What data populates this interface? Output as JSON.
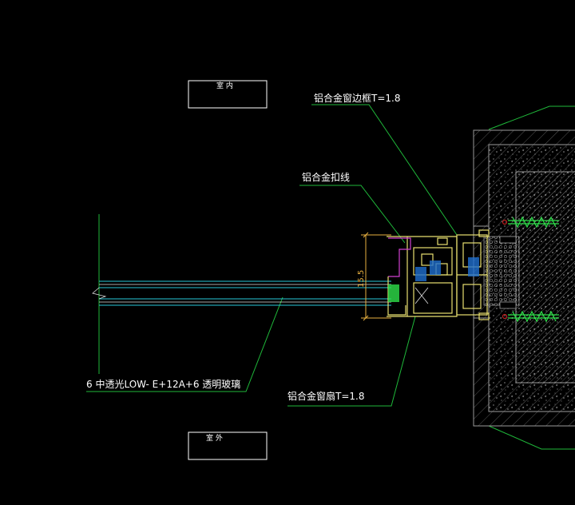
{
  "labels": {
    "room_indoor": "室 内",
    "room_outdoor": "室 外",
    "frame": "铝合金窗边框T=1.8",
    "bead": "铝合金扣线",
    "glass": "6 中透光LOW- E+12A+6 透明玻璃",
    "sash": "铝合金窗扇T=1.8",
    "dimension": "15.5"
  },
  "colors": {
    "background": "#000000",
    "leader": "#1fb83a",
    "glass_edge": "#28c8d8",
    "wall_outline": "#9a9a9a",
    "profile": "#e8e070",
    "profile_bead": "#d040d0",
    "dimension": "#e8b040",
    "anchor": "#2ee04a",
    "seal": "#c02020"
  }
}
